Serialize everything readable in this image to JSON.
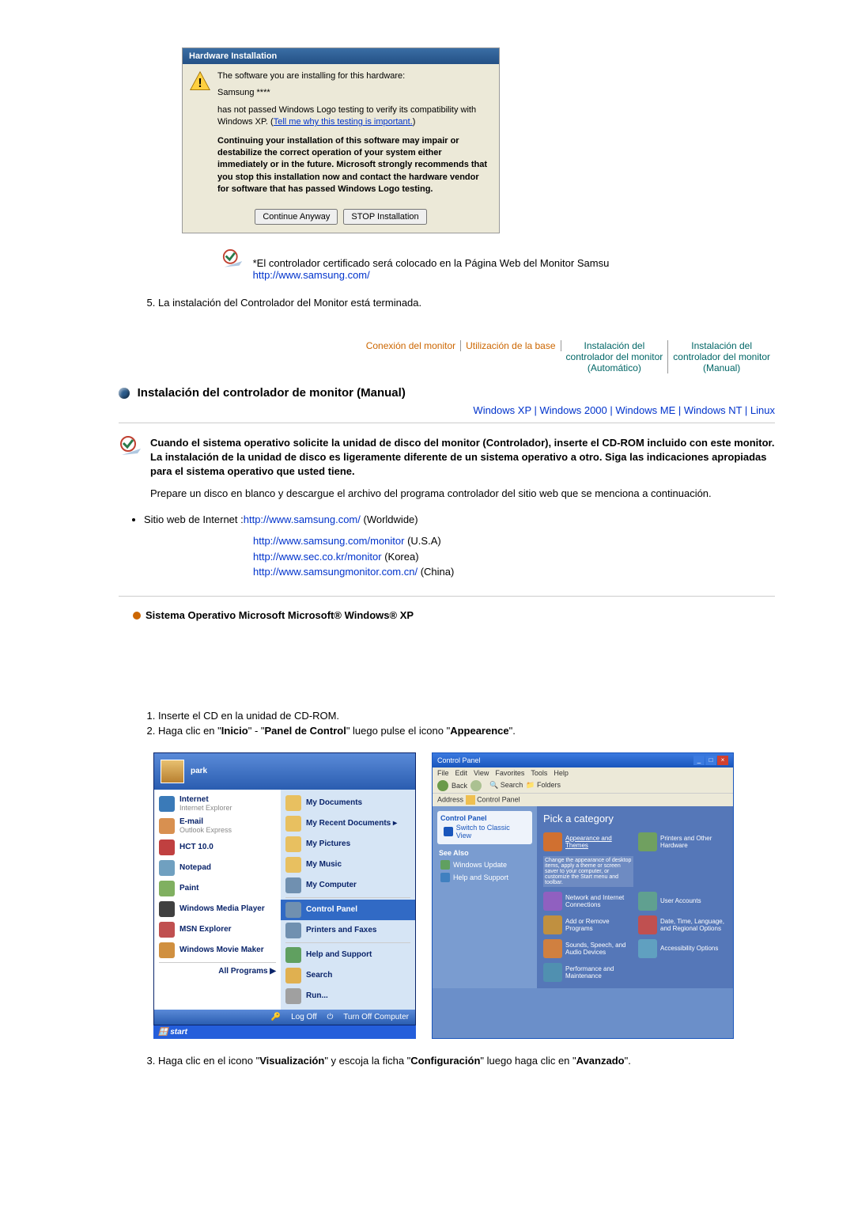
{
  "dialog": {
    "title": "Hardware Installation",
    "line1": "The software you are installing for this hardware:",
    "device": "Samsung ****",
    "line2": "has not passed Windows Logo testing to verify its compatibility with Windows XP. (",
    "link": "Tell me why this testing is important.",
    "line2_end": ")",
    "warn": "Continuing your installation of this software may impair or destabilize the correct operation of your system either immediately or in the future. Microsoft strongly recommends that you stop this installation now and contact the hardware vendor for software that has passed Windows Logo testing.",
    "btn_continue": "Continue Anyway",
    "btn_stop": "STOP Installation"
  },
  "note": {
    "text": "*El controlador certificado será colocado en la Página Web del Monitor Samsu",
    "url": "http://www.samsung.com/"
  },
  "step5": "La instalación del Controlador del Monitor está terminada.",
  "nav": {
    "t1": "Conexión del monitor",
    "t2": "Utilización de la base",
    "t3a": "Instalación del",
    "t3b": "controlador del monitor",
    "t3c": "(Automático)",
    "t4a": "Instalación del",
    "t4b": "controlador del monitor",
    "t4c": "(Manual)"
  },
  "section_title": "Instalación del controlador de monitor (Manual)",
  "os_links": {
    "xp": "Windows XP",
    "w2k": "Windows 2000",
    "me": "Windows ME",
    "nt": "Windows NT",
    "linux": "Linux",
    "sep": " | "
  },
  "info": {
    "bold_text": "Cuando el sistema operativo solicite la unidad de disco del monitor (Controlador), inserte el CD-ROM incluido con este monitor. La instalación de la unidad de disco es ligeramente diferente de un sistema operativo a otro. Siga las indicaciones apropiadas para el sistema operativo que usted tiene.",
    "plain_text": "Prepare un disco en blanco y descargue el archivo del programa controlador del sitio web que se menciona a continuación."
  },
  "sitelist": {
    "label": "Sitio web de Internet :",
    "items": [
      {
        "url": "http://www.samsung.com/",
        "suffix": "(Worldwide)"
      },
      {
        "url": "http://www.samsung.com/monitor",
        "suffix": "(U.S.A)"
      },
      {
        "url": "http://www.sec.co.kr/monitor",
        "suffix": "(Korea)"
      },
      {
        "url": "http://www.samsungmonitor.com.cn/",
        "suffix": "(China)"
      }
    ]
  },
  "os_heading": "Sistema Operativo Microsoft Microsoft® Windows® XP",
  "steps12": {
    "s1": "Inserte el CD en la unidad de CD-ROM.",
    "s2a": "Haga clic en \"",
    "s2b": "Inicio",
    "s2c": "\" - \"",
    "s2d": "Panel de Control",
    "s2e": "\" luego pulse el icono \"",
    "s2f": "Appearence",
    "s2g": "\"."
  },
  "startmenu": {
    "user": "park",
    "left": [
      {
        "title": "Internet",
        "sub": "Internet Explorer",
        "color": "#3a7ab8"
      },
      {
        "title": "E-mail",
        "sub": "Outlook Express",
        "color": "#d89050"
      },
      {
        "title": "HCT 10.0",
        "sub": "",
        "color": "#c04040"
      },
      {
        "title": "Notepad",
        "sub": "",
        "color": "#70a0c0"
      },
      {
        "title": "Paint",
        "sub": "",
        "color": "#80b060"
      },
      {
        "title": "Windows Media Player",
        "sub": "",
        "color": "#404040"
      },
      {
        "title": "MSN Explorer",
        "sub": "",
        "color": "#c05050"
      },
      {
        "title": "Windows Movie Maker",
        "sub": "",
        "color": "#d09040"
      }
    ],
    "allprograms": "All Programs",
    "right": [
      {
        "label": "My Documents",
        "color": "#e8c060"
      },
      {
        "label": "My Recent Documents",
        "color": "#e8c060",
        "arrow": true
      },
      {
        "label": "My Pictures",
        "color": "#e8c060"
      },
      {
        "label": "My Music",
        "color": "#e8c060"
      },
      {
        "label": "My Computer",
        "color": "#7090b0"
      },
      {
        "label": "Control Panel",
        "color": "#7090b0",
        "selected": true
      },
      {
        "label": "Printers and Faxes",
        "color": "#7090b0"
      },
      {
        "label": "Help and Support",
        "color": "#60a060"
      },
      {
        "label": "Search",
        "color": "#e0b050"
      },
      {
        "label": "Run...",
        "color": "#a0a0a0"
      }
    ],
    "logoff": "Log Off",
    "turnoff": "Turn Off Computer",
    "start": "start"
  },
  "cp": {
    "title": "Control Panel",
    "menu": [
      "File",
      "Edit",
      "View",
      "Favorites",
      "Tools",
      "Help"
    ],
    "tb_back": "Back",
    "tb_search": "Search",
    "tb_folders": "Folders",
    "addr_label": "Address",
    "addr_value": "Control Panel",
    "side_title": "Control Panel",
    "side_switch": "Switch to Classic View",
    "seealso": "See Also",
    "seealso_items": [
      "Windows Update",
      "Help and Support"
    ],
    "main_heading": "Pick a category",
    "cats": [
      {
        "label": "Appearance and Themes",
        "color": "#d07030",
        "sel": true
      },
      {
        "label": "Printers and Other Hardware",
        "color": "#70a060"
      },
      {
        "sub": "Change the appearance of desktop items, apply a theme or screen saver to your computer, or customize the Start menu and toolbar.",
        "info": true
      },
      {
        "label": "Network and Internet Connections",
        "color": "#9060c0"
      },
      {
        "label": "User Accounts",
        "color": "#60a090"
      },
      {
        "label": "Add or Remove Programs",
        "color": "#c09040"
      },
      {
        "label": "Date, Time, Language, and Regional Options",
        "color": "#c05050"
      },
      {
        "label": "Sounds, Speech, and Audio Devices",
        "color": "#d08040"
      },
      {
        "label": "Accessibility Options",
        "color": "#60a0c0"
      },
      {
        "label": "Performance and Maintenance",
        "color": "#5090b0"
      }
    ]
  },
  "step3": {
    "a": "Haga clic en el icono \"",
    "b": "Visualización",
    "c": "\" y escoja la ficha \"",
    "d": "Configuración",
    "e": "\" luego haga clic en \"",
    "f": "Avanzado",
    "g": "\"."
  }
}
